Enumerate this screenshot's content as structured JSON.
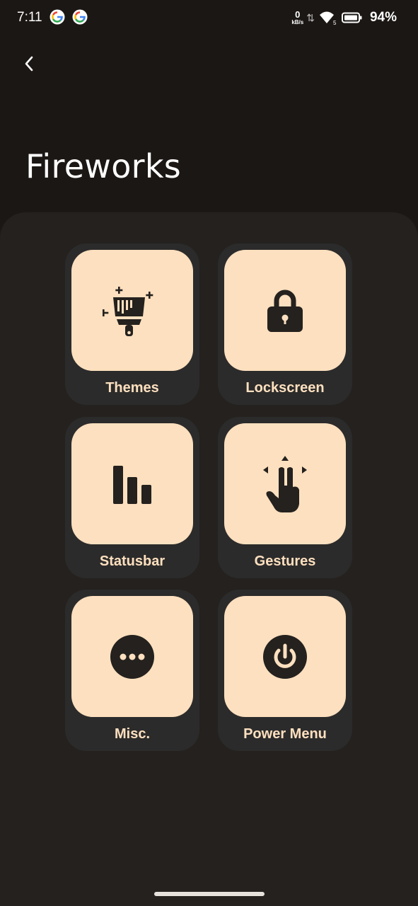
{
  "statusbar": {
    "time": "7:11",
    "netspeed_value": "0",
    "netspeed_unit": "kB/s",
    "wifi_badge": "5",
    "battery_pct": "94%"
  },
  "header": {
    "title": "Fireworks"
  },
  "tiles": [
    {
      "label": "Themes",
      "icon": "paintbrush-sparkle-icon"
    },
    {
      "label": "Lockscreen",
      "icon": "lock-icon"
    },
    {
      "label": "Statusbar",
      "icon": "bar-chart-icon"
    },
    {
      "label": "Gestures",
      "icon": "two-finger-gesture-icon"
    },
    {
      "label": "Misc.",
      "icon": "more-dots-icon"
    },
    {
      "label": "Power Menu",
      "icon": "power-icon"
    }
  ],
  "colors": {
    "background": "#1b1714",
    "panel": "#24211e",
    "tile": "#2c2b2b",
    "tile_accent": "#fde0bf",
    "icon": "#24211e"
  }
}
